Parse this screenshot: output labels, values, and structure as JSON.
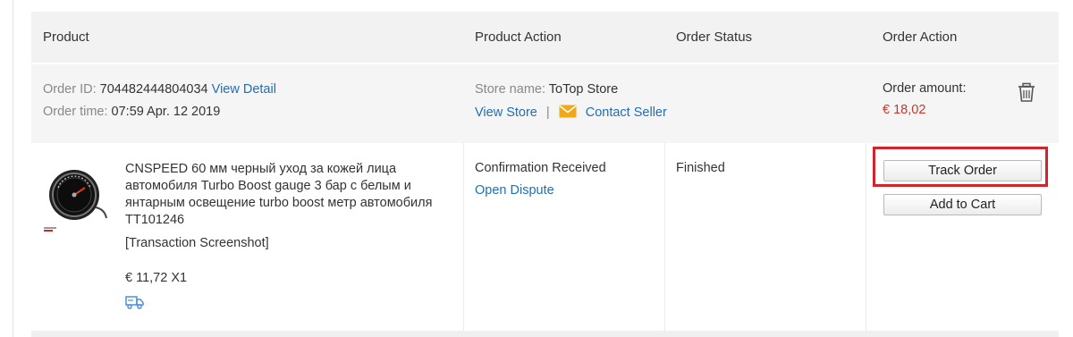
{
  "header": {
    "product": "Product",
    "product_action": "Product Action",
    "order_status": "Order Status",
    "order_action": "Order Action"
  },
  "order": {
    "id_label": "Order ID:",
    "id_value": "704482444804034",
    "view_detail": "View Detail",
    "time_label": "Order time:",
    "time_value": "07:59 Apr. 12 2019",
    "store_label": "Store name:",
    "store_name": "ToTop Store",
    "view_store": "View Store",
    "separator": "|",
    "contact_seller": "Contact Seller",
    "amount_label": "Order amount:",
    "amount_value": "€ 18,02"
  },
  "item": {
    "title": "CNSPEED 60 мм черный уход за кожей лица автомобиля Turbo Boost gauge 3 бар с белым и янтарным освещение turbo boost метр автомобиля TT101246",
    "screenshot_link": "[Transaction Screenshot]",
    "price_qty": "€ 11,72 X1",
    "product_action_status": "Confirmation Received",
    "open_dispute": "Open Dispute",
    "order_status": "Finished"
  },
  "actions": {
    "track_order": "Track Order",
    "add_to_cart": "Add to Cart"
  },
  "icons": {
    "envelope": "envelope-icon",
    "trash": "trash-icon",
    "truck": "delivery-truck-icon"
  },
  "colors": {
    "link": "#1f6fb5",
    "price": "#c6372b",
    "highlight": "#d0252b",
    "envelope": "#f0a818"
  }
}
